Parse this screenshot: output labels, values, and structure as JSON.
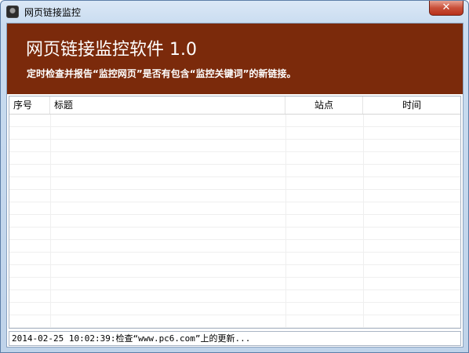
{
  "window": {
    "title": "网页链接监控",
    "close_label": "✕"
  },
  "banner": {
    "title": "网页链接监控软件 1.0",
    "subtitle": "定时检查并报告“监控网页”是否有包含“监控关键词”的新链接。",
    "background": "#7b2a0b"
  },
  "table": {
    "columns": [
      "序号",
      "标题",
      "站点",
      "时间"
    ],
    "rows": []
  },
  "status": {
    "text": "2014-02-25 10:02:39:检查“www.pc6.com”上的更新..."
  }
}
